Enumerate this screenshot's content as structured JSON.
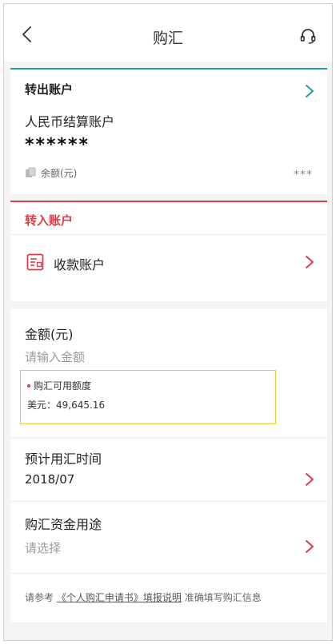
{
  "header": {
    "title": "购汇"
  },
  "transfer_out": {
    "title": "转出账户",
    "account_name": "人民币结算账户",
    "masked_number": "******",
    "balance_label": "余额(元)",
    "balance_value": "***"
  },
  "transfer_in": {
    "title": "转入账户",
    "receiving_account_label": "收款账户"
  },
  "amount": {
    "label": "金额(元)",
    "placeholder": "请输入金额",
    "quota_title": "购汇可用额度",
    "quota_value": "美元：49,645.16"
  },
  "planned_time": {
    "label": "预计用汇时间",
    "value": "2018/07"
  },
  "purpose": {
    "label": "购汇资金用途",
    "placeholder": "请选择"
  },
  "note": {
    "prefix": "请参考",
    "link": "《个人购汇申请书》填报说明",
    "suffix": "准确填写购汇信息"
  },
  "colors": {
    "out_accent": "#1aa0a8",
    "in_accent": "#e03b48",
    "quota_border": "#f0c93a"
  }
}
